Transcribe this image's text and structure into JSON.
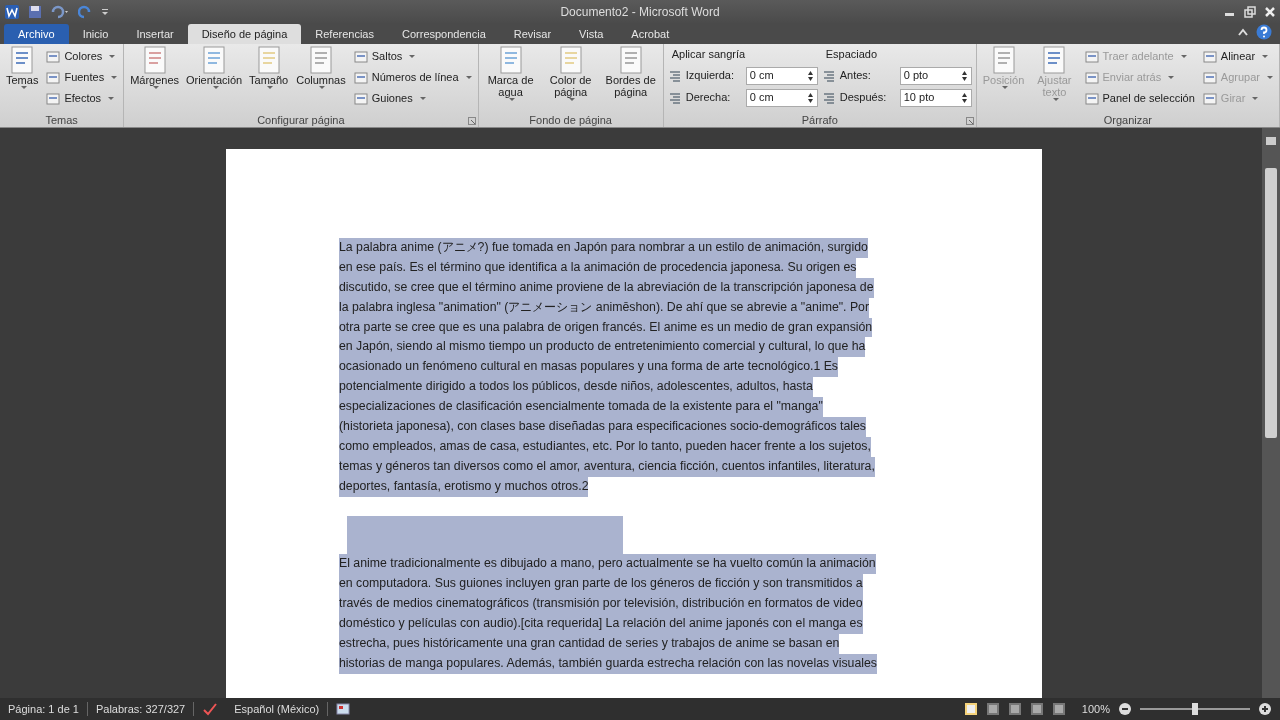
{
  "window": {
    "title": "Documento2 - Microsoft Word"
  },
  "tabs": [
    {
      "label": "Archivo",
      "kind": "file",
      "selected": false
    },
    {
      "label": "Inicio",
      "kind": "tab",
      "selected": false
    },
    {
      "label": "Insertar",
      "kind": "tab",
      "selected": false
    },
    {
      "label": "Diseño de página",
      "kind": "tab",
      "selected": true
    },
    {
      "label": "Referencias",
      "kind": "tab",
      "selected": false
    },
    {
      "label": "Correspondencia",
      "kind": "tab",
      "selected": false
    },
    {
      "label": "Revisar",
      "kind": "tab",
      "selected": false
    },
    {
      "label": "Vista",
      "kind": "tab",
      "selected": false
    },
    {
      "label": "Acrobat",
      "kind": "tab",
      "selected": false
    }
  ],
  "ribbon": [
    {
      "label": "Temas",
      "launcher": false,
      "columns": [
        [
          {
            "kind": "large",
            "label": "Temas",
            "menu": true,
            "disabled": false
          }
        ],
        [
          {
            "kind": "small",
            "label": "Colores",
            "menu": true,
            "disabled": false
          },
          {
            "kind": "small",
            "label": "Fuentes",
            "menu": true,
            "disabled": false
          },
          {
            "kind": "small",
            "label": "Efectos",
            "menu": true,
            "disabled": false
          }
        ]
      ]
    },
    {
      "label": "Configurar página",
      "launcher": true,
      "columns": [
        [
          {
            "kind": "large",
            "label": "Márgenes",
            "menu": true,
            "disabled": false
          }
        ],
        [
          {
            "kind": "large",
            "label": "Orientación",
            "menu": true,
            "disabled": false
          }
        ],
        [
          {
            "kind": "large",
            "label": "Tamaño",
            "menu": true,
            "disabled": false
          }
        ],
        [
          {
            "kind": "large",
            "label": "Columnas",
            "menu": true,
            "disabled": false
          }
        ],
        [
          {
            "kind": "small",
            "label": "Saltos",
            "menu": true,
            "disabled": false
          },
          {
            "kind": "small",
            "label": "Números de línea",
            "menu": true,
            "disabled": false
          },
          {
            "kind": "small",
            "label": "Guiones",
            "menu": true,
            "disabled": false
          }
        ]
      ]
    },
    {
      "label": "Fondo de página",
      "launcher": false,
      "columns": [
        [
          {
            "kind": "large",
            "label": "Marca de agua",
            "menu": true,
            "disabled": false
          }
        ],
        [
          {
            "kind": "large",
            "label": "Color de página",
            "menu": true,
            "disabled": false
          }
        ],
        [
          {
            "kind": "large",
            "label": "Bordes de página",
            "menu": false,
            "disabled": false
          }
        ]
      ]
    },
    {
      "label": "Párrafo",
      "launcher": true,
      "columns": [
        [
          {
            "kind": "heading",
            "label": "Aplicar sangría"
          },
          {
            "kind": "spin",
            "label": "Izquierda:",
            "value": "0 cm"
          },
          {
            "kind": "spin",
            "label": "Derecha:",
            "value": "0 cm"
          }
        ],
        [
          {
            "kind": "heading",
            "label": "Espaciado"
          },
          {
            "kind": "spin",
            "label": "Antes:",
            "value": "0 pto"
          },
          {
            "kind": "spin",
            "label": "Después:",
            "value": "10 pto"
          }
        ]
      ]
    },
    {
      "label": "Organizar",
      "launcher": false,
      "columns": [
        [
          {
            "kind": "large",
            "label": "Posición",
            "menu": true,
            "disabled": true
          }
        ],
        [
          {
            "kind": "large",
            "label": "Ajustar texto",
            "menu": true,
            "disabled": true
          }
        ],
        [
          {
            "kind": "small",
            "label": "Traer adelante",
            "menu": true,
            "disabled": true
          },
          {
            "kind": "small",
            "label": "Enviar atrás",
            "menu": true,
            "disabled": true
          },
          {
            "kind": "small",
            "label": "Panel de selección",
            "menu": false,
            "disabled": false
          }
        ],
        [
          {
            "kind": "small",
            "label": "Alinear",
            "menu": true,
            "disabled": false
          },
          {
            "kind": "small",
            "label": "Agrupar",
            "menu": true,
            "disabled": true
          },
          {
            "kind": "small",
            "label": "Girar",
            "menu": true,
            "disabled": true
          }
        ]
      ]
    }
  ],
  "document": {
    "paragraphs": [
      {
        "kind": "text",
        "selected": true,
        "lines": [
          "La palabra anime (アニメ?) fue tomada en Japón para nombrar a un estilo de animación, surgido",
          "en ese país. Es el término que identifica a la animación de procedencia japonesa. Su origen es",
          "discutido, se cree que el término anime proviene de la abreviación de la transcripción japonesa de",
          "la palabra inglesa \"animation\" (アニメーション animēshon). De ahí que se abrevie a \"anime\". Por",
          "otra parte se cree que es una palabra de origen francés. El anime es un medio de gran expansión",
          "en Japón, siendo al mismo tiempo un producto de entretenimiento comercial y cultural, lo que ha",
          "ocasionado un fenómeno cultural en masas populares y una forma de arte tecnológico.1 Es",
          "potencialmente dirigido a todos los públicos, desde niños, adolescentes, adultos, hasta",
          "especializaciones de clasificación esencialmente tomada de la existente para el \"manga\"",
          "(historieta japonesa), con clases base diseñadas para especificaciones socio-demográficos tales",
          "como empleados, amas de casa, estudiantes, etc. Por lo tanto, pueden hacer frente a los sujetos,",
          "temas y géneros tan diversos como el amor, aventura, ciencia ficción, cuentos infantiles, literatura,",
          "deportes, fantasía, erotismo y muchos otros.2"
        ]
      },
      {
        "kind": "empty",
        "selected": true
      },
      {
        "kind": "text",
        "selected": true,
        "lines": [
          "El anime tradicionalmente es dibujado a mano, pero actualmente se ha vuelto común la animación",
          "en computadora. Sus guiones incluyen gran parte de los géneros de ficción y son transmitidos a",
          "través de medios cinematográficos (transmisión por televisión, distribución en formatos de video",
          "doméstico y películas con audio).[cita requerida] La relación del anime japonés con el manga es",
          "estrecha, pues históricamente una gran cantidad de series y trabajos de anime se basan en",
          "historias de manga populares. Además, también guarda estrecha relación con las novelas visuales"
        ]
      }
    ]
  },
  "status_bar": {
    "page": "Página: 1 de 1",
    "words": "Palabras: 327/327",
    "language": "Español (México)",
    "zoom": "100%",
    "level": 0.5
  }
}
